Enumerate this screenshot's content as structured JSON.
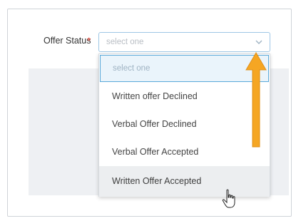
{
  "form": {
    "field_label": "Offer Status",
    "required_marker": "*",
    "select": {
      "placeholder": "select one",
      "chevron_icon": "chevron-down-icon"
    },
    "options": [
      {
        "label": "select one"
      },
      {
        "label": "Written offer Declined"
      },
      {
        "label": "Verbal Offer Declined"
      },
      {
        "label": "Verbal Offer Accepted"
      },
      {
        "label": "Written Offer Accepted"
      }
    ]
  },
  "annotation": {
    "arrow_icon": "orange-arrow-up-icon",
    "arrow_color": "#f5a623",
    "cursor_icon": "hand-pointer-icon"
  },
  "colors": {
    "accent_border": "#5aa9d9",
    "required": "#d93a2b",
    "panel_bg": "#eef0f3"
  }
}
